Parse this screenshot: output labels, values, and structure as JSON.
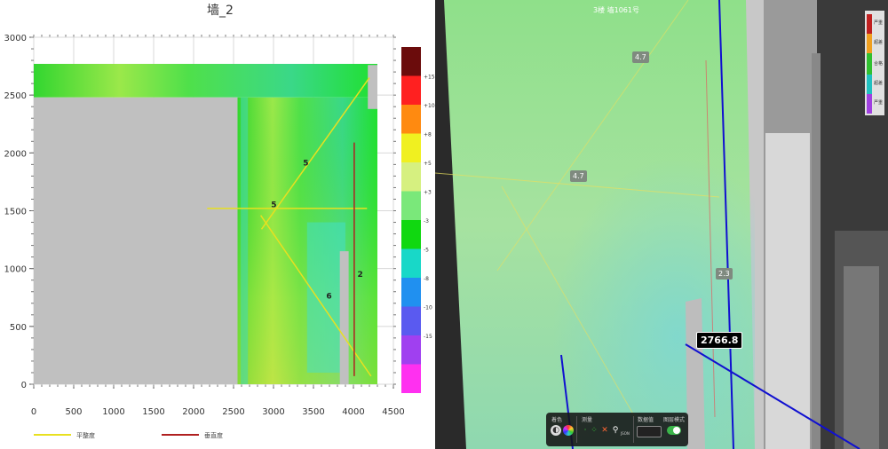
{
  "left_chart": {
    "title": "墙_2",
    "legend": {
      "horizontal": "平整度",
      "vertical": "垂直度",
      "horizontal_color": "#e8e020",
      "vertical_color": "#b02020"
    },
    "color_scale": {
      "labels": [
        "+15",
        "+10",
        "+8",
        "+5",
        "+3",
        "-3",
        "-5",
        "-8",
        "-10",
        "-15"
      ],
      "colors": [
        "#6b0c0c",
        "#ff2020",
        "#ff8a10",
        "#f0f020",
        "#d6f080",
        "#7ae87a",
        "#10d810",
        "#18d8c8",
        "#2090f0",
        "#5a5af0",
        "#a040f0",
        "#ff30f0"
      ]
    },
    "annotations": [
      "5",
      "5",
      "6",
      "2"
    ]
  },
  "chart_data": {
    "type": "heatmap",
    "title": "墙_2",
    "xlabel": "",
    "ylabel": "",
    "xlim": [
      0,
      4500
    ],
    "ylim": [
      0,
      3000
    ],
    "x_ticks": [
      "0",
      "500",
      "1000",
      "1500",
      "2000",
      "2500",
      "3000",
      "3500",
      "4000",
      "4500"
    ],
    "y_ticks": [
      "0",
      "500",
      "1000",
      "1500",
      "2000",
      "2500",
      "3000"
    ],
    "grid": true,
    "legend_placement": "bottom",
    "series": [
      {
        "name": "平整度",
        "color": "#e8e020"
      },
      {
        "name": "垂直度",
        "color": "#b02020"
      }
    ]
  },
  "scan_view": {
    "title": "3楼 墙1061号",
    "measurement": "2766.8",
    "callouts": [
      "4.7",
      "4.7",
      "2.3"
    ],
    "legend": {
      "labels": [
        "严重",
        "超差",
        "合格",
        "超差",
        "严重"
      ],
      "colors": [
        "#c02020",
        "#f0a020",
        "#30c030",
        "#20c0c0",
        "#a040e0"
      ]
    },
    "toolbar": {
      "section1": "着色",
      "section2": "测量",
      "section3": "数据值",
      "section4": "图层模式",
      "unit": "JSON"
    }
  }
}
